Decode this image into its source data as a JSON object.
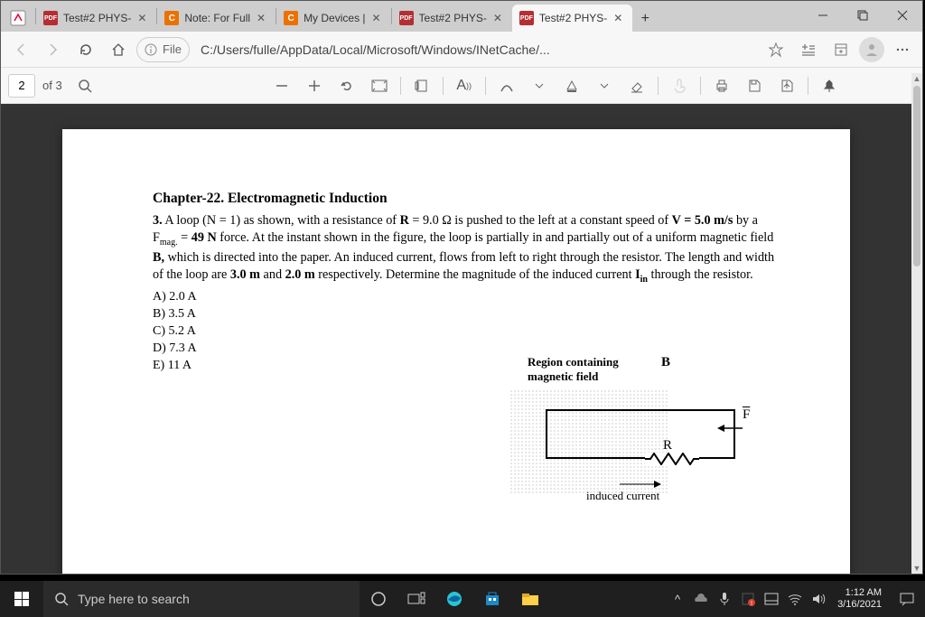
{
  "tabs": [
    {
      "icon": "pdf",
      "label": "Test#2 PHYS-"
    },
    {
      "icon": "chegg",
      "label": "Note: For Full"
    },
    {
      "icon": "chegg",
      "label": "My Devices | "
    },
    {
      "icon": "pdf",
      "label": "Test#2 PHYS-"
    },
    {
      "icon": "pdf",
      "label": "Test#2 PHYS-"
    }
  ],
  "active_tab_index": 4,
  "addr": {
    "file_badge": "File",
    "url": "C:/Users/fulle/AppData/Local/Microsoft/Windows/INetCache/..."
  },
  "pdf_toolbar": {
    "page_current": "2",
    "page_total": "of 3"
  },
  "document": {
    "chapter": "Chapter-22. Electromagnetic Induction",
    "question_num": "3.",
    "question_body_html": "A loop (N = 1) as shown, with a resistance of R = 9.0 Ω is pushed to the left at a constant speed of V = 5.0 m/s by a F<sub>mag.</sub> = 49 N force.  At the instant shown in the figure, the loop is partially in and partially out of a uniform magnetic field B, which is directed into the paper.  An induced current, flows from left to right through the resistor.  The length and width of the loop are 3.0 m and 2.0 m respectively. Determine the magnitude of the induced current I<sub>in</sub> through the resistor.",
    "answers": [
      "A)  2.0 A",
      "B)  3.5 A",
      "C)  5.2 A",
      "D)  7.3 A",
      "E)  11 A"
    ],
    "figure": {
      "region_line1": "Region containing",
      "region_line2": "magnetic field",
      "B": "B",
      "R": "R",
      "F": "F",
      "induced": "induced current"
    }
  },
  "taskbar": {
    "search_placeholder": "Type here to search",
    "time": "1:12 AM",
    "date": "3/16/2021"
  }
}
